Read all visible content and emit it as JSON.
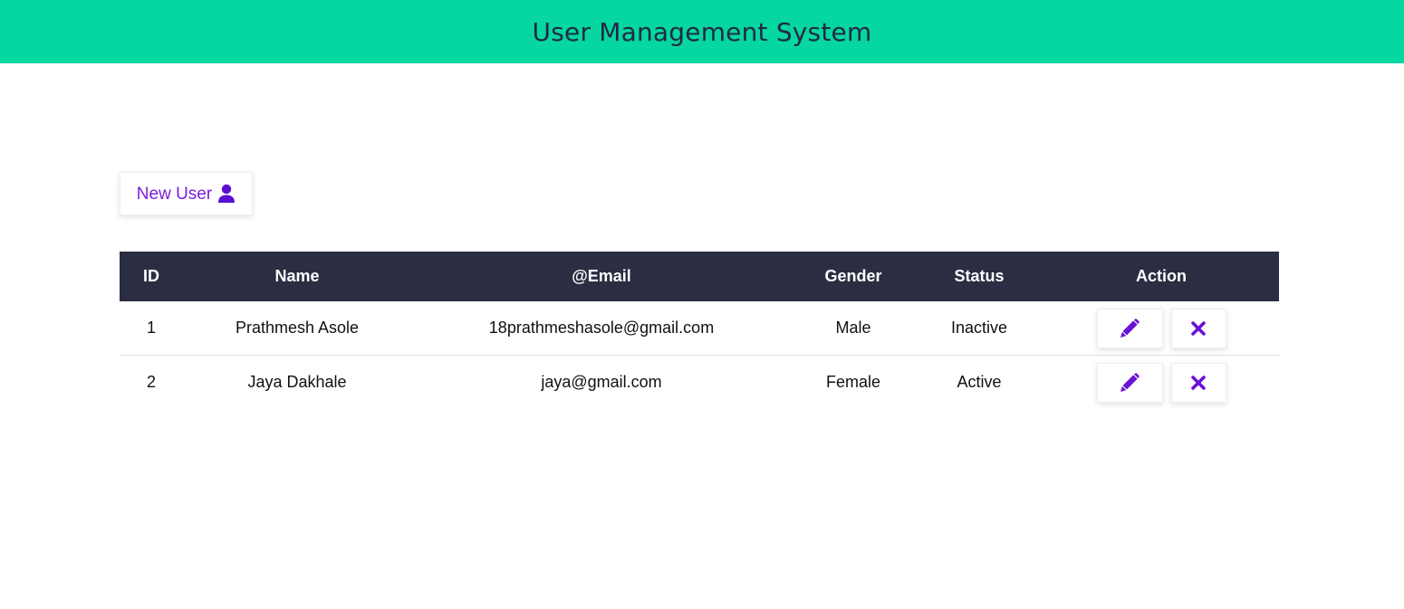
{
  "header": {
    "title": "User Management System"
  },
  "toolbar": {
    "new_user_label": "New User",
    "new_user_icon": "user-icon"
  },
  "table": {
    "columns": [
      "ID",
      "Name",
      "@Email",
      "Gender",
      "Status",
      "Action"
    ],
    "rows": [
      {
        "id": "1",
        "name": "Prathmesh Asole",
        "email": "18prathmeshasole@gmail.com",
        "gender": "Male",
        "status": "Inactive"
      },
      {
        "id": "2",
        "name": "Jaya Dakhale",
        "email": "jaya@gmail.com",
        "gender": "Female",
        "status": "Active"
      }
    ],
    "row_actions": [
      "pencil-icon",
      "close-icon"
    ]
  },
  "colors": {
    "header_bg": "#06d6a0",
    "header_text": "#1f2a44",
    "table_head_bg": "#2b2d42",
    "accent": "#7a1fd6"
  }
}
